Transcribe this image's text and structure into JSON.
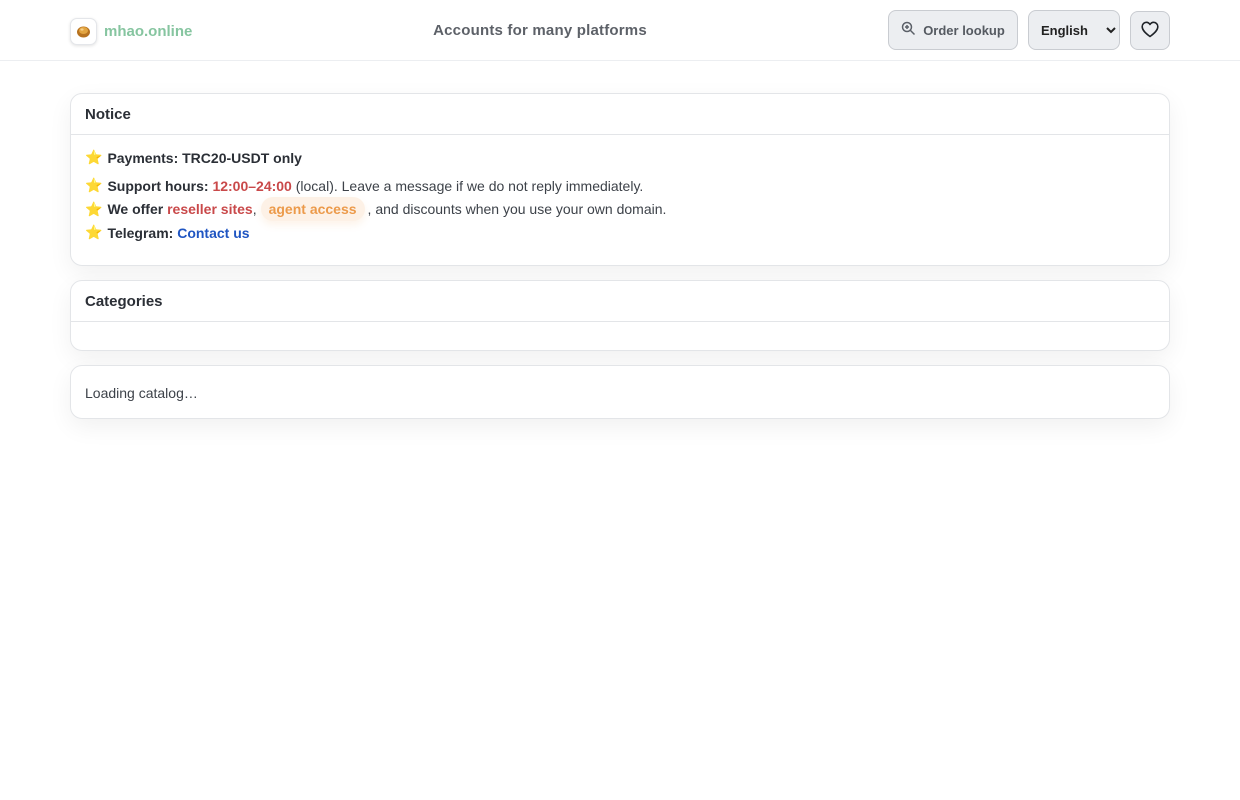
{
  "header": {
    "brand_name": "mhao.online",
    "tagline": "Accounts for many platforms",
    "order_lookup_label": "Order lookup",
    "language_options": [
      "English"
    ],
    "language_selected": "English"
  },
  "notice": {
    "title": "Notice",
    "star": "⭐",
    "payments_label": "Payments: TRC20-USDT only",
    "support_label": "Support hours:",
    "support_hours": "12:00–24:00",
    "support_rest": " (local). Leave a message if we do not reply immediately.",
    "offer_label": "We offer",
    "reseller_sites": "reseller sites",
    "comma": ",",
    "agent_access": "agent access",
    "offer_rest": ", and discounts when you use your own domain.",
    "telegram_label": "Telegram:",
    "contact_link": "Contact us"
  },
  "categories": {
    "title": "Categories"
  },
  "catalog": {
    "loading_text": "Loading catalog…"
  },
  "colors": {
    "brand": "#86c5a0",
    "highlight_red": "#c9494a",
    "highlight_orange": "#ec9a4a",
    "link": "#1f55c2"
  }
}
